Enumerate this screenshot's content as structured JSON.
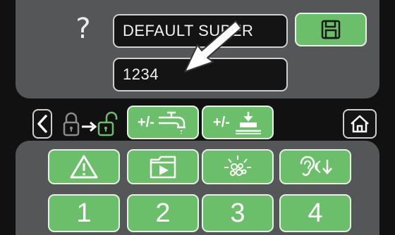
{
  "header": {
    "help_glyph": "?",
    "name_value": "DEFAULT SUPER",
    "code_value": "1234",
    "save_icon": "save-icon"
  },
  "toolbar": {
    "back_icon": "chevron-left-icon",
    "unlock_icon": "lock-to-unlock-icon",
    "faucet_button_label": "+/-",
    "ground_button_label": "+/-",
    "home_icon": "home-icon"
  },
  "function_buttons": [
    {
      "icon": "warning-icon"
    },
    {
      "icon": "folder-play-icon"
    },
    {
      "icon": "bubbles-light-icon"
    },
    {
      "icon": "ear-volume-down-icon"
    }
  ],
  "number_buttons": [
    "1",
    "2",
    "3",
    "4"
  ],
  "overlay": {
    "arrow_icon": "pointer-arrow-icon"
  },
  "colors": {
    "panel": "#555657",
    "green": "#6cbf6a",
    "field": "#141414",
    "arrow": "#ffffff"
  }
}
